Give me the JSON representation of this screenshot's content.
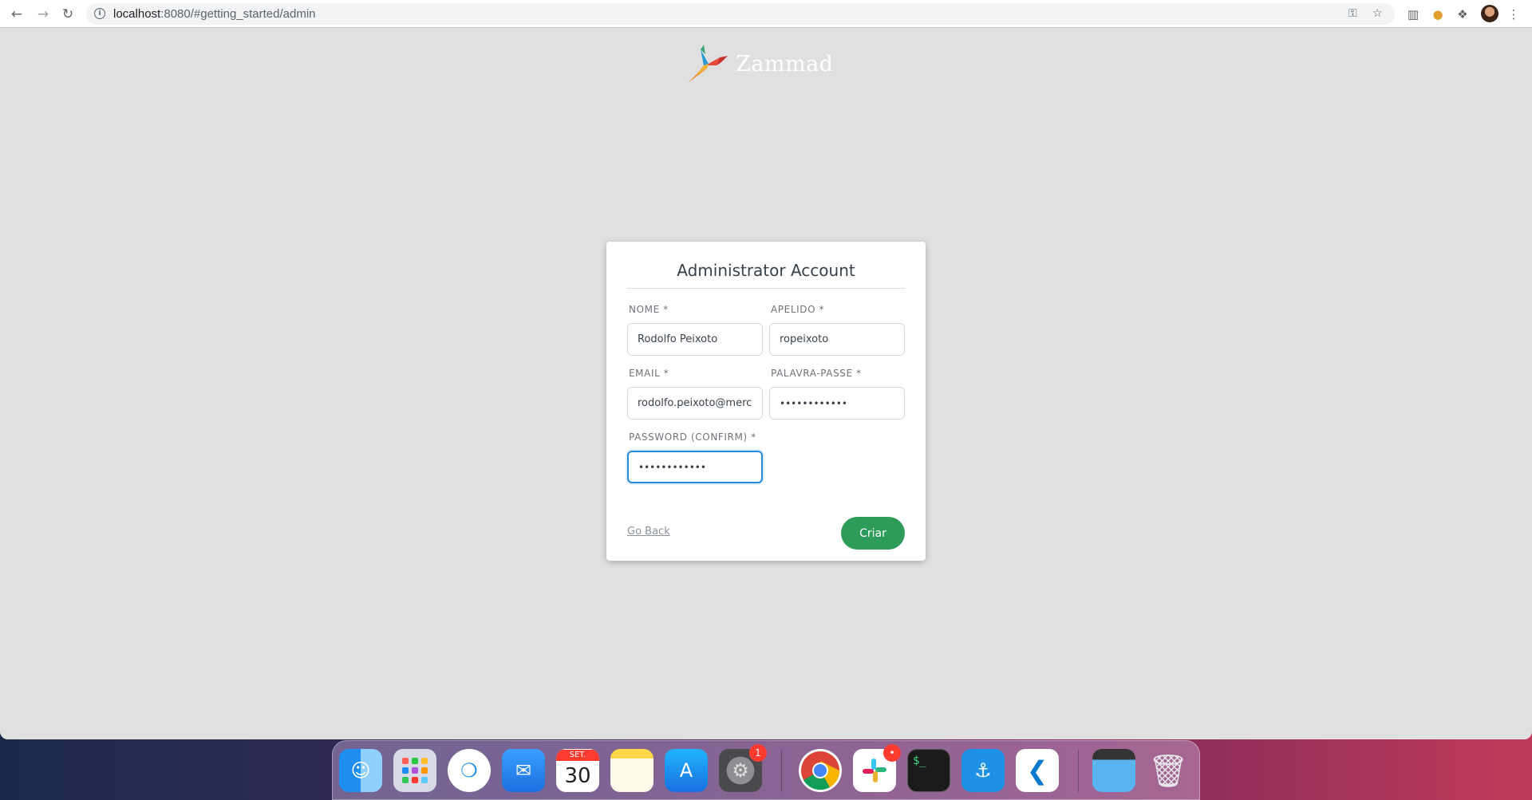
{
  "browser": {
    "url_host": "localhost",
    "url_rest": ":8080/#getting_started/admin",
    "back_icon": "arrow-left-icon",
    "forward_icon": "arrow-right-icon",
    "reload_icon": "reload-icon"
  },
  "app": {
    "logo_text": "Zammad"
  },
  "form": {
    "title": "Administrator Account",
    "nome_label": "NOME *",
    "nome_value": "Rodolfo Peixoto",
    "apelido_label": "APELIDO *",
    "apelido_value": "ropeixoto",
    "email_label": "EMAIL *",
    "email_value": "rodolfo.peixoto@merc",
    "password_label": "PALAVRA-PASSE *",
    "password_value": "••••••••••••",
    "confirm_label": "PASSWORD (CONFIRM) *",
    "confirm_value": "••••••••••••",
    "go_back": "Go Back",
    "submit": "Criar"
  },
  "dock": {
    "calendar_month": "SET.",
    "calendar_day": "30",
    "settings_badge": "1",
    "slack_badge": "•"
  },
  "colors": {
    "accent_green": "#2d9b5a",
    "focus_blue": "#2a8ad8"
  }
}
